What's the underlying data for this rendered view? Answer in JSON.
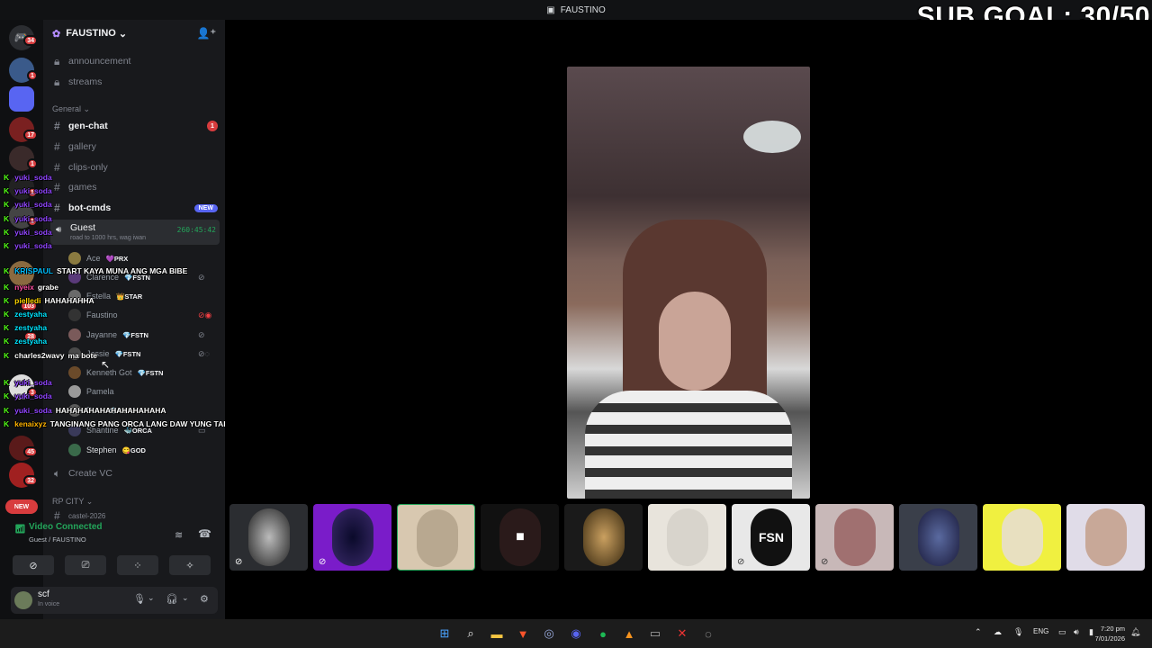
{
  "window": {
    "title": "FAUSTINO"
  },
  "overlay": {
    "sub_goal": "SUB GOAL: 30/50"
  },
  "rail": {
    "badges": [
      "34",
      "1",
      "17",
      "1",
      "1",
      "1",
      "103",
      "28",
      "3",
      "45",
      "32"
    ],
    "new_label": "NEW"
  },
  "server": {
    "name": "FAUSTINO",
    "channels": [
      {
        "name": "announcement",
        "icon": "lock-icon"
      },
      {
        "name": "streams",
        "icon": "lock-icon"
      }
    ],
    "category_general": "General",
    "general_channels": [
      {
        "name": "gen-chat",
        "badge": "1",
        "unread": true
      },
      {
        "name": "gallery"
      },
      {
        "name": "clips-only"
      },
      {
        "name": "games"
      },
      {
        "name": "bot-cmds",
        "tag": "NEW",
        "unread": true
      }
    ],
    "voice_channel": {
      "name": "Guest",
      "status": "road to 1000 hrs, wag iwan",
      "timer": "260:45:42"
    },
    "voice_users": [
      {
        "name": "Ace",
        "tag": "💜PRX"
      },
      {
        "name": "Clarence",
        "tag": "💎FSTN"
      },
      {
        "name": "Estella",
        "tag": "👑STAR"
      },
      {
        "name": "Faustino",
        "tag": ""
      },
      {
        "name": "Jayanne",
        "tag": "💎FSTN"
      },
      {
        "name": "Jessie",
        "tag": "💎FSTN"
      },
      {
        "name": "Kenneth Got",
        "tag": "💎FSTN"
      },
      {
        "name": "Pamela",
        "tag": ""
      },
      {
        "name": "Prao",
        "tag": "💎FSTN"
      },
      {
        "name": "Shantine",
        "tag": "🐳ORCA"
      },
      {
        "name": "Stephen",
        "tag": "😋GOD"
      }
    ],
    "create_vc": "Create VC",
    "category_rp": "RP CITY",
    "partial_channel": "castel-2026"
  },
  "chat_overlay": [
    {
      "user": "yuki_soda",
      "msg": "",
      "color": "#9146ff"
    },
    {
      "user": "yuki_soda",
      "msg": "",
      "color": "#9146ff"
    },
    {
      "user": "yuki_soda",
      "msg": "",
      "color": "#9146ff"
    },
    {
      "user": "yuki_soda",
      "msg": "",
      "color": "#9146ff"
    },
    {
      "user": "yuki_soda",
      "msg": "",
      "color": "#9146ff"
    },
    {
      "user": "yuki_soda",
      "msg": "",
      "color": "#9146ff"
    },
    {
      "user": "KRISPAUL",
      "msg": "START KAYA MUNA ANG MGA BIBE",
      "color": "#00bfff"
    },
    {
      "user": "nyeix",
      "msg": "grabe",
      "color": "#ff4fa3"
    },
    {
      "user": "pielledi",
      "msg": "HAHAHAHHA",
      "color": "#ffd700"
    },
    {
      "user": "zestyaha",
      "msg": "",
      "color": "#00e5ff"
    },
    {
      "user": "zestyaha",
      "msg": "",
      "color": "#00e5ff"
    },
    {
      "user": "zestyaha",
      "msg": "",
      "color": "#00e5ff"
    },
    {
      "user": "charles2wavy",
      "msg": "ma bote",
      "color": "#ffffff"
    },
    {
      "user": "yuki_soda",
      "msg": "",
      "color": "#9146ff"
    },
    {
      "user": "yuki_soda",
      "msg": "",
      "color": "#9146ff"
    },
    {
      "user": "yuki_soda",
      "msg": "HAHAHAHAHAHAHAHAHAHA",
      "color": "#9146ff"
    },
    {
      "user": "kenaixyz",
      "msg": "TANGINANG PANG ORCA LANG DAW YUNG TAHOL NIYA HAHAHA",
      "color": "#ffb300"
    }
  ],
  "voice_panel": {
    "status": "Video Connected",
    "path": "Guest / FAUSTINO",
    "user_name": "scf",
    "user_status": "In voice"
  },
  "stage": {
    "tiles": [
      "user-tile-1",
      "user-tile-2",
      "user-tile-3",
      "user-tile-4",
      "user-tile-5",
      "user-tile-6",
      "user-tile-7",
      "user-tile-8",
      "user-tile-9",
      "user-tile-10",
      "user-tile-11"
    ]
  },
  "taskbar": {
    "lang": "ENG",
    "time": "7:20 pm",
    "date": "7/01/2026"
  },
  "colors": {
    "accent": "#5865f2",
    "voice_green": "#23a55a",
    "badge_red": "#d83c3e"
  }
}
